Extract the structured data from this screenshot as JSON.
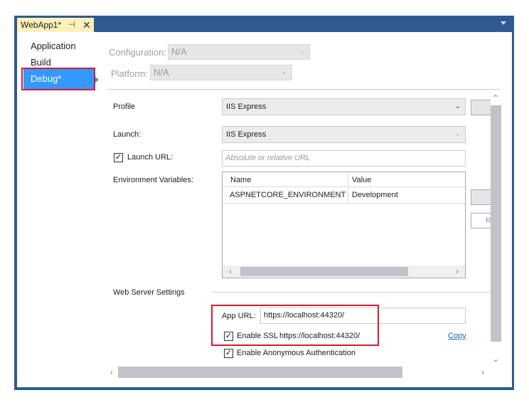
{
  "document_tab": {
    "title": "WebApp1*",
    "pin_glyph": "⊣",
    "close_glyph": "✕"
  },
  "nav": {
    "items": [
      "Application",
      "Build",
      "Debug*"
    ]
  },
  "configuration": {
    "label": "Configuration:",
    "value": "N/A"
  },
  "platform": {
    "label": "Platform:",
    "value": "N/A"
  },
  "profile": {
    "label": "Profile",
    "value": "IIS Express"
  },
  "launch": {
    "label": "Launch:",
    "value": "IIS Express"
  },
  "launch_url": {
    "checkbox_label": "Launch URL:",
    "checked": true,
    "placeholder": "Absolute or relative URL"
  },
  "env": {
    "label": "Environment Variables:",
    "columns": [
      "Name",
      "Value"
    ],
    "rows": [
      {
        "name": "ASPNETCORE_ENVIRONMENT",
        "value": "Development"
      }
    ]
  },
  "web_server": {
    "section_label": "Web Server Settings",
    "app_url_label": "App URL:",
    "app_url_value": "https://localhost:44320/",
    "enable_ssl_label": "Enable SSL",
    "ssl_url": "https://localhost:44320/",
    "copy_link": "Copy",
    "anon_auth_label": "Enable Anonymous Authentication",
    "ssl_checked": true,
    "anon_checked": true
  },
  "side_button_fragment": "R",
  "colors": {
    "frame": "#2d5b91",
    "tab_active": "#fff1ba",
    "nav_selected": "#3399ff",
    "highlight": "#e0182a",
    "link": "#1a5fd7"
  }
}
